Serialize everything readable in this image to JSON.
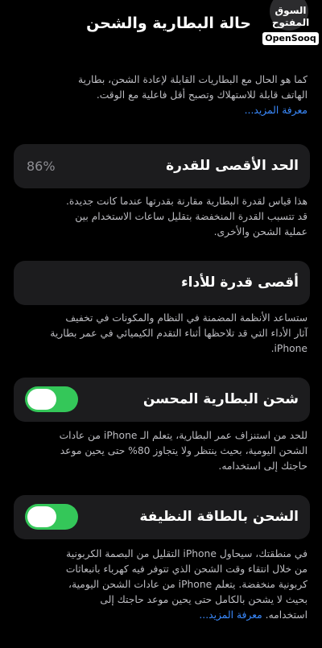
{
  "header": {
    "title": "حالة البطارية والشحن"
  },
  "watermark": {
    "arabic": "السوق المفتوح",
    "english": "OpenSooq"
  },
  "intro": {
    "lines": [
      "كما هو الحال مع البطاريات القابلة لإعادة الشحن، بطارية",
      "الهاتف قابلة للاستهلاك وتصبح أقل فاعلية مع الوقت."
    ],
    "link": "معرفة المزيد..."
  },
  "max_capacity": {
    "label": "الحد الأقصى للقدرة",
    "value": "86%",
    "lines": [
      "هذا قياس لقدرة البطارية مقارنة بقدرتها عندما كانت جديدة.",
      "قد تتسبب القدرة المنخفضة بتقليل ساعات الاستخدام بين",
      "عملية الشحن والأخرى."
    ]
  },
  "peak_performance": {
    "label": "أقصى قدرة للأداء",
    "lines": [
      "ستساعد الأنظمة المضمنة في النظام والمكونات في تخفيف",
      "آثار الأداء التي قد تلاحظها أثناء التقدم الكيميائي في عمر بطارية",
      "iPhone."
    ]
  },
  "optimized_charging": {
    "label": "شحن البطارية المحسن",
    "enabled": true,
    "lines": [
      "للحد من استنزاف عمر البطارية، يتعلم الـ iPhone من عادات",
      "الشحن اليومية، بحيث ينتظر ولا يتجاوز 80% حتى يحين موعد",
      "حاجتك إلى استخدامه."
    ]
  },
  "clean_energy": {
    "label": "الشحن بالطاقة النظيفة",
    "enabled": true,
    "lines": [
      "في منطقتك، سيحاول iPhone التقليل من البصمة الكربونية",
      "من خلال انتقاء وقت الشحن الذي تتوفر فيه كهرباء بانبعاثات",
      "كربونية منخفضة. يتعلم iPhone من عادات الشحن اليومية،",
      "بحيث لا يشحن بالكامل حتى يحين موعد حاجتك إلى"
    ],
    "last_line": "استخدامه.",
    "link": "معرفة المزيد..."
  },
  "colors": {
    "background": "#000000",
    "card": "#1c1c1e",
    "accent_link": "#3b8bff",
    "toggle_on": "#34c759"
  }
}
